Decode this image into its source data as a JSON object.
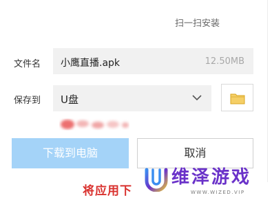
{
  "header": {
    "scan_install": "扫一扫安装"
  },
  "form": {
    "filename_label": "文件名",
    "filename_value": "小鹰直播.apk",
    "filesize": "12.50MB",
    "saveto_label": "保存到",
    "saveto_value": "U盘",
    "dropdown_icon": "chevron-down-icon",
    "folder_icon": "folder-icon"
  },
  "buttons": {
    "download": "下载到电脑",
    "cancel": "取消"
  },
  "footer": {
    "caption": "将应用下"
  },
  "watermark": {
    "brand": "维泽游戏",
    "sub": "WWW.WIZED.VIP"
  },
  "colors": {
    "download_disabled_bg": "#a4d3f8",
    "caption_red": "#d9312e",
    "folder_yellow": "#f0c14b",
    "brand_purple": "#6a32c9"
  }
}
